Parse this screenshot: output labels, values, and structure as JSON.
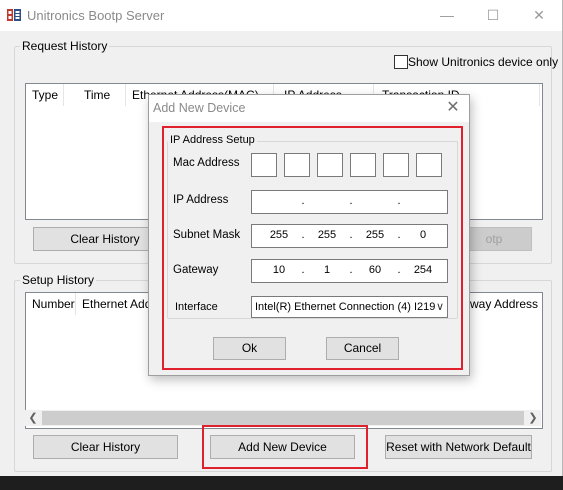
{
  "window": {
    "title": "Unitronics Bootp Server",
    "minimize": "—",
    "maximize": "☐",
    "close": "✕"
  },
  "request_history": {
    "label": "Request History",
    "show_unitronics_only": "Show Unitronics device only",
    "columns": [
      "Type",
      "Time",
      "Ethernet Address(MAC)",
      "IP Address",
      "Transaction ID"
    ],
    "clear_history": "Clear History",
    "bootp_button_partial": "otp"
  },
  "setup_history": {
    "label": "Setup History",
    "columns": [
      "Number",
      "Ethernet Address",
      "Gateway Address"
    ],
    "clear_history": "Clear History",
    "add_new_device": "Add New Device",
    "reset_network_default": "Reset with Network Default"
  },
  "dialog": {
    "title": "Add New Device",
    "close": "✕",
    "group_label": "IP Address Setup",
    "mac_label": "Mac Address",
    "ip_label": "IP Address",
    "subnet_label": "Subnet Mask",
    "gateway_label": "Gateway",
    "interface_label": "Interface",
    "ip_octets": [
      "",
      "",
      "",
      ""
    ],
    "subnet_octets": [
      "255",
      "255",
      "255",
      "0"
    ],
    "gateway_octets": [
      "10",
      "1",
      "60",
      "254"
    ],
    "interface_value": "Intel(R) Ethernet Connection (4) I219",
    "ok": "Ok",
    "cancel": "Cancel"
  }
}
